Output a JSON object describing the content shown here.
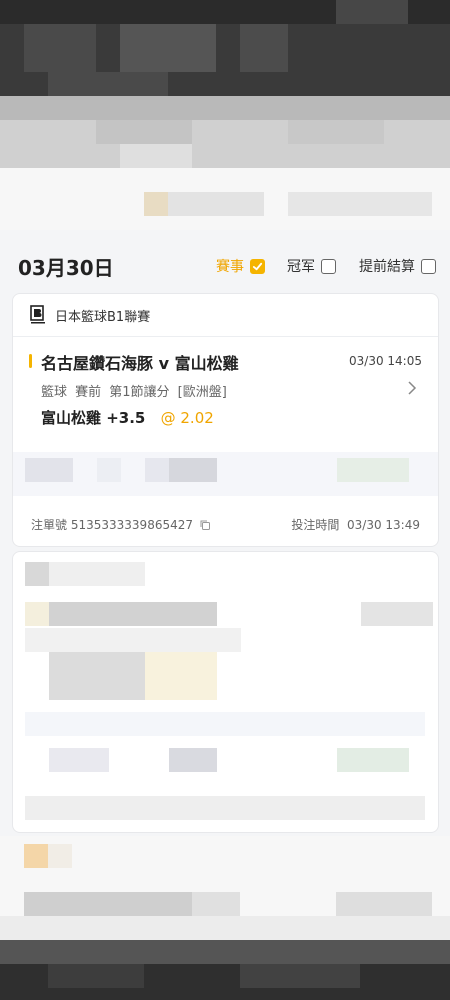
{
  "header": {
    "date": "03月30日",
    "filters": [
      {
        "label": "賽事",
        "checked": true
      },
      {
        "label": "冠军",
        "checked": false
      },
      {
        "label": "提前結算",
        "checked": false
      }
    ]
  },
  "bet_card": {
    "league": "日本籃球B1聯賽",
    "match": "名古屋鑽石海豚 v 富山松雞",
    "match_time": "03/30 14:05",
    "market": "籃球  賽前  第1節讓分 [歐洲盤]",
    "pick": "富山松雞 +3.5",
    "odds": "@ 2.02",
    "ticket_label": "注單號",
    "ticket_no": "5135333339865427",
    "bet_time_label": "投注時間",
    "bet_time": "03/30 13:49"
  },
  "icons": {
    "league_logo": "b-league-logo-icon",
    "check": "check-icon",
    "chevron": "chevron-right-icon",
    "copy": "copy-icon"
  },
  "colors": {
    "accent": "#f5b400",
    "odds": "#f0a500",
    "card_bg": "#ffffff",
    "page_bg": "#f4f5f7"
  }
}
